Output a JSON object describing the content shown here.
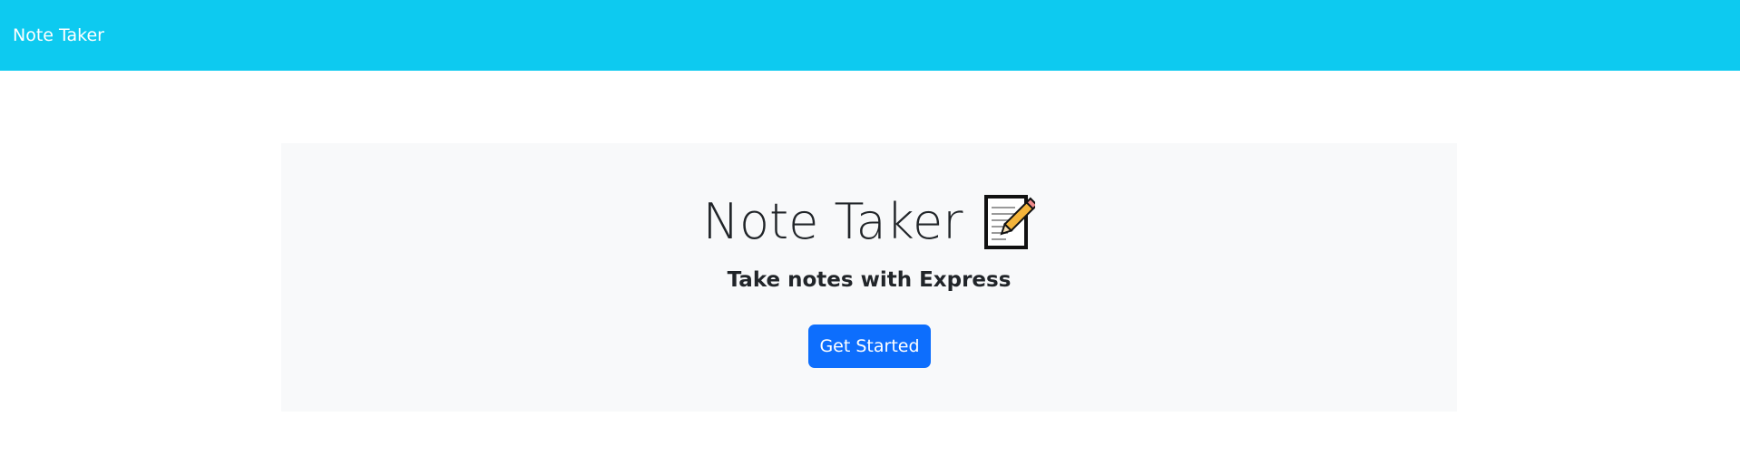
{
  "navbar": {
    "brand": "Note Taker",
    "background_color": "#0dcaf0"
  },
  "hero": {
    "title": "Note Taker",
    "icon": "memo-icon",
    "subtitle": "Take notes with Express",
    "button_label": "Get Started",
    "button_color": "#0d6efd",
    "background_color": "#f8f9fa"
  }
}
